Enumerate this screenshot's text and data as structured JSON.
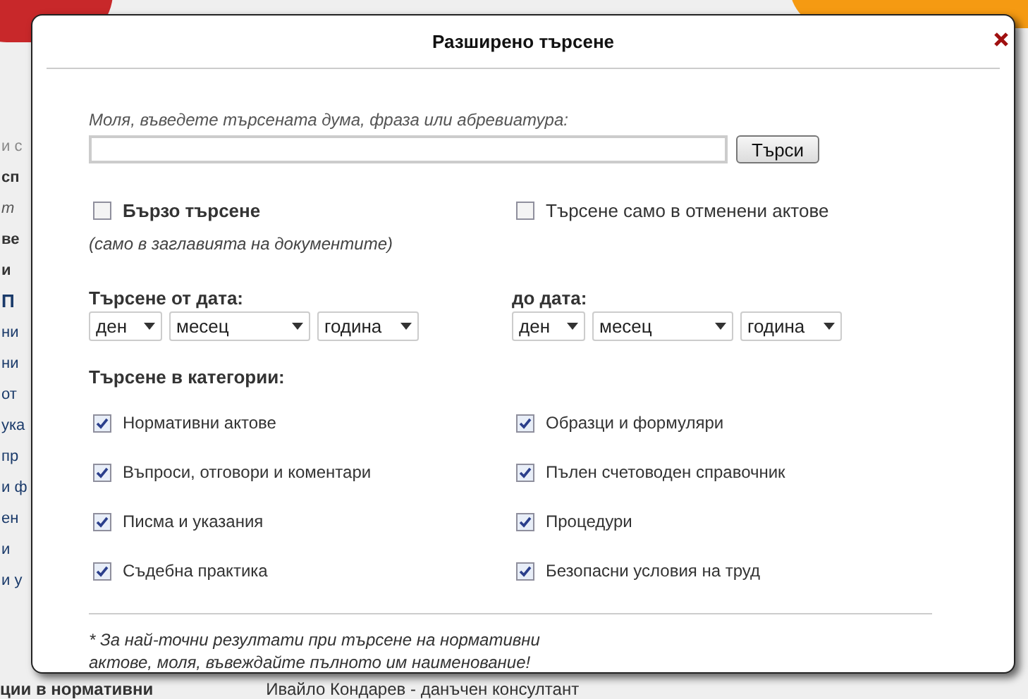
{
  "background_page": {
    "side_fragments": [
      {
        "text": "и с",
        "kind": "plain"
      },
      {
        "text": "сп",
        "kind": "bold"
      },
      {
        "text": "т",
        "kind": "italic"
      },
      {
        "text": "ве",
        "kind": "bold"
      },
      {
        "text": "и",
        "kind": "bold"
      },
      {
        "text": "П",
        "kind": "heading"
      },
      {
        "text": "ни",
        "kind": "link"
      },
      {
        "text": "ни",
        "kind": "link"
      },
      {
        "text": "от",
        "kind": "link"
      },
      {
        "text": "ука",
        "kind": "link"
      },
      {
        "text": "пр",
        "kind": "link"
      },
      {
        "text": "и ф",
        "kind": "link"
      },
      {
        "text": "ен",
        "kind": "link"
      },
      {
        "text": "и",
        "kind": "link"
      },
      {
        "text": "и у",
        "kind": "link"
      }
    ],
    "bottom_left": "ции в нормативни",
    "bottom_author": "Ивайло Кондарев - данъчен консултант"
  },
  "dialog": {
    "title": "Разширено търсене",
    "search": {
      "label": "Моля, въведете търсената дума, фраза или абревиатура:",
      "button": "Търси"
    },
    "options": [
      {
        "label": "Бързо търсене",
        "note": "(само в заглавията на документите)",
        "checked": false
      },
      {
        "label": "Търсене само в отменени актове",
        "checked": false
      }
    ],
    "date_ranges": [
      {
        "label": "Търсене от дата:",
        "selects": [
          "ден",
          "месец",
          "година"
        ]
      },
      {
        "label": "до дата:",
        "selects": [
          "ден",
          "месец",
          "година"
        ]
      }
    ],
    "categories": {
      "heading": "Търсене в категории:",
      "items": [
        {
          "label": "Нормативни актове",
          "checked": true
        },
        {
          "label": "Образци и формуляри",
          "checked": true
        },
        {
          "label": "Въпроси, отговори и коментари",
          "checked": true
        },
        {
          "label": "Пълен счетоводен справочник",
          "checked": true
        },
        {
          "label": "Писма и указания",
          "checked": true
        },
        {
          "label": "Процедури",
          "checked": true
        },
        {
          "label": "Съдебна практика",
          "checked": true
        },
        {
          "label": "Безопасни условия на труд",
          "checked": true
        }
      ]
    },
    "footnote": "* За най-точни резултати при търсене на нормативни актове, моля, въвеждайте пълното им наименование!"
  }
}
